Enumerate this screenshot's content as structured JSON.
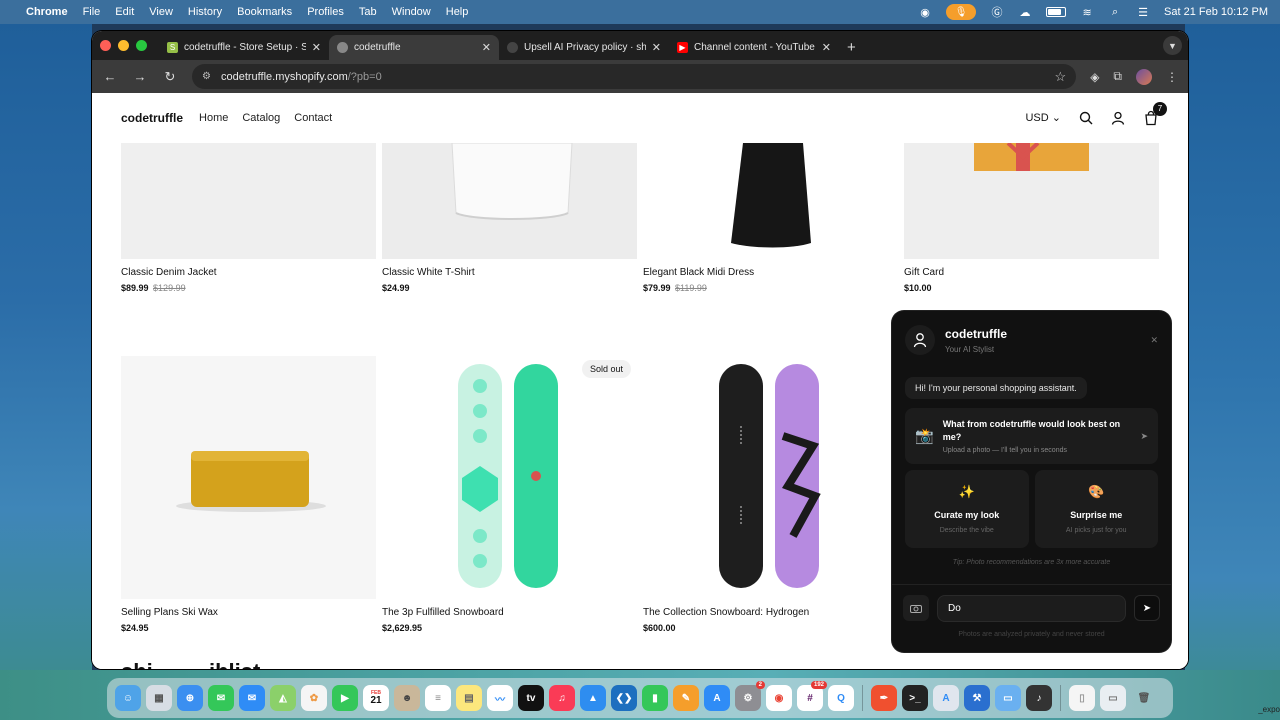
{
  "menubar": {
    "app": "Chrome",
    "items": [
      "File",
      "Edit",
      "View",
      "History",
      "Bookmarks",
      "Profiles",
      "Tab",
      "Window",
      "Help"
    ],
    "clock": "Sat 21 Feb  10:12 PM"
  },
  "tabs": [
    {
      "title": "codetruffle - Store Setup · Sh",
      "icon": "shopify-icon",
      "active": false
    },
    {
      "title": "codetruffle",
      "icon": "globe-icon",
      "active": true
    },
    {
      "title": "Upsell AI Privacy policy · shiv",
      "icon": "github-icon",
      "active": false
    },
    {
      "title": "Channel content - YouTube St",
      "icon": "youtube-icon",
      "active": false
    }
  ],
  "address": {
    "host": "codetruffle.myshopify.com",
    "path": "/?pb=0"
  },
  "store": {
    "brand": "codetruffle",
    "nav": [
      "Home",
      "Catalog",
      "Contact"
    ],
    "currency": "USD",
    "cart_count": "7"
  },
  "products": [
    {
      "title": "Classic Denim Jacket",
      "price": "$89.99",
      "old_price": "$129.99"
    },
    {
      "title": "Classic White T-Shirt",
      "price": "$24.99",
      "old_price": ""
    },
    {
      "title": "Elegant Black Midi Dress",
      "price": "$79.99",
      "old_price": "$119.99"
    },
    {
      "title": "Gift Card",
      "price": "$10.00",
      "old_price": ""
    },
    {
      "title": "Selling Plans Ski Wax",
      "price": "$24.95",
      "old_price": ""
    },
    {
      "title": "The 3p Fulfilled Snowboard",
      "price": "$2,629.95",
      "old_price": "",
      "badge": "Sold out"
    },
    {
      "title": "The Collection Snowboard: Hydrogen",
      "price": "$600.00",
      "old_price": ""
    }
  ],
  "bottom_heading": "shi…  … iblist",
  "chat": {
    "name": "codetruffle",
    "subtitle": "Your AI Stylist",
    "greeting": "Hi! I'm your personal shopping assistant.",
    "prompt_title": "What from codetruffle would look best on me?",
    "prompt_sub": "Upload a photo — I'll tell you in seconds",
    "option1_title": "Curate my look",
    "option1_sub": "Describe the vibe",
    "option2_title": "Surprise me",
    "option2_sub": "AI picks just for you",
    "tip": "Tip: Photo recommendations are 3x more accurate",
    "input_value": "Do",
    "privacy": "Photos are analyzed privately and never stored"
  },
  "dock": {
    "calendar_day": "21",
    "calendar_month": "FEB",
    "settings_badge": "2",
    "slack_badge": "192"
  },
  "desktop_file": "_expo"
}
